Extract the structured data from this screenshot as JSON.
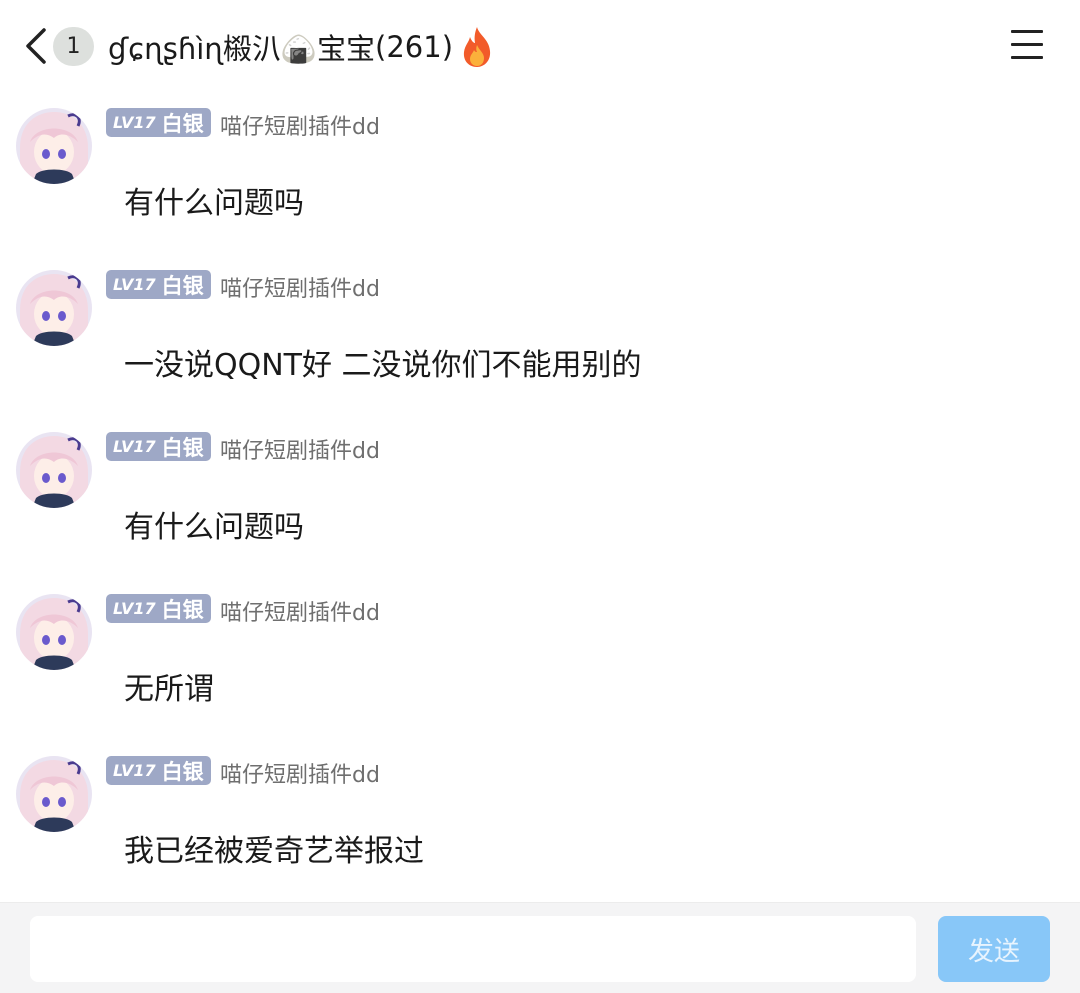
{
  "header": {
    "unread_count": "1",
    "title": "ɠɕɳʂɦìɳ榝汃🍙宝宝",
    "member_count": "(261)"
  },
  "messages": [
    {
      "level": "LV17",
      "rank": "白银",
      "sender": "喵仔短剧插件dd",
      "text": "有什么问题吗"
    },
    {
      "level": "LV17",
      "rank": "白银",
      "sender": "喵仔短剧插件dd",
      "text": "一没说QQNT好 二没说你们不能用别的"
    },
    {
      "level": "LV17",
      "rank": "白银",
      "sender": "喵仔短剧插件dd",
      "text": "有什么问题吗"
    },
    {
      "level": "LV17",
      "rank": "白银",
      "sender": "喵仔短剧插件dd",
      "text": "无所谓"
    },
    {
      "level": "LV17",
      "rank": "白银",
      "sender": "喵仔短剧插件dd",
      "text": "我已经被爱奇艺举报过"
    }
  ],
  "input": {
    "placeholder": "",
    "value": ""
  },
  "send_label": "发送",
  "colors": {
    "level_badge": "#9ea8c6",
    "send_button": "#88c7f8",
    "input_bar": "#f4f4f5"
  }
}
